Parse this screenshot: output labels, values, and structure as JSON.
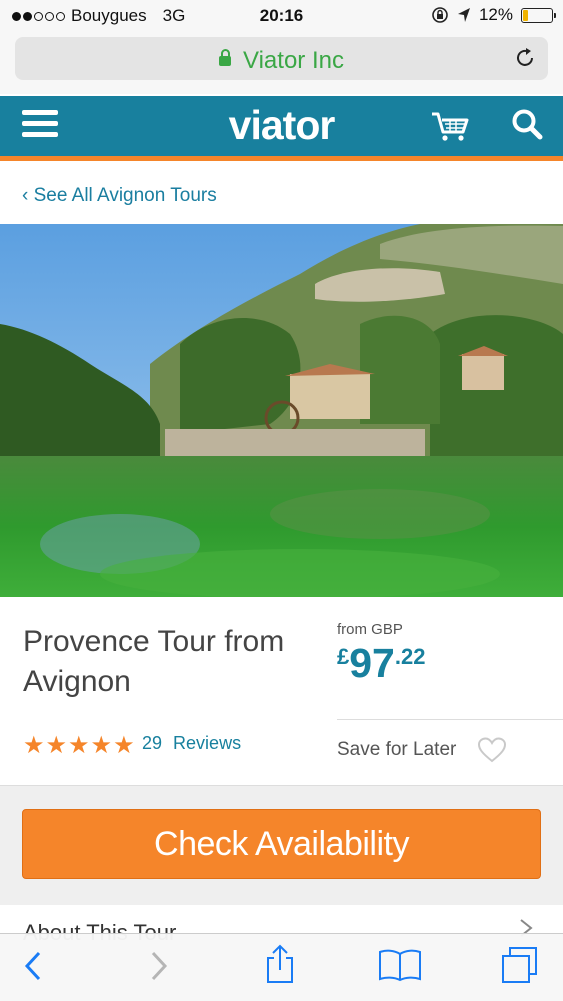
{
  "status_bar": {
    "carrier": "Bouygues",
    "network": "3G",
    "time": "20:16",
    "battery": "12%"
  },
  "browser": {
    "site_name": "Viator Inc"
  },
  "header": {
    "logo": "viator"
  },
  "back_link": "See All Avignon Tours",
  "tour": {
    "title": "Provence Tour from Avignon",
    "price_prefix": "from GBP",
    "price_currency": "£",
    "price_whole": "97",
    "price_cents": ".22",
    "rating": 5,
    "review_count": "29",
    "reviews_label": "Reviews",
    "save_label": "Save for Later"
  },
  "cta_label": "Check Availability",
  "about_label": "About This Tour",
  "colors": {
    "brand_blue": "#18809e",
    "accent_orange": "#f5852a",
    "secure_green": "#3aa745"
  }
}
